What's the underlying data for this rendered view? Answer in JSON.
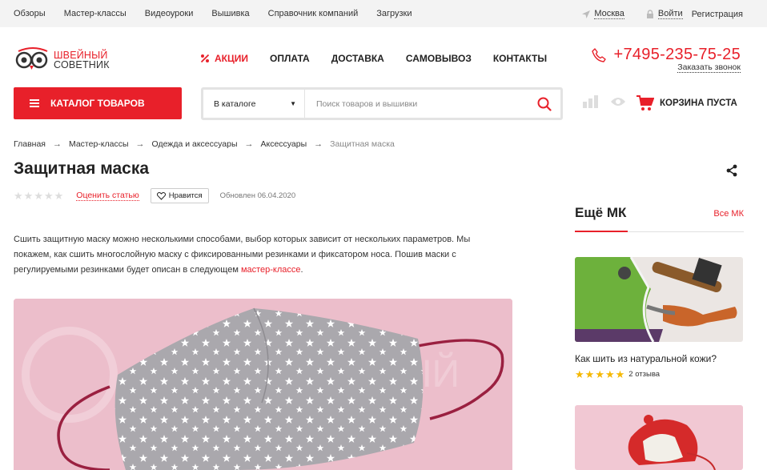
{
  "topbar": {
    "nav": [
      "Обзоры",
      "Мастер-классы",
      "Видеоуроки",
      "Вышивка",
      "Справочник компаний",
      "Загрузки"
    ],
    "city": "Москва",
    "login": "Войти",
    "register": "Регистрация"
  },
  "header": {
    "logo_line1": "ШВЕЙНЫЙ",
    "logo_line2": "СОВЕТНИК",
    "nav": [
      "АКЦИИ",
      "ОПЛАТА",
      "ДОСТАВКА",
      "САМОВЫВОЗ",
      "КОНТАКТЫ"
    ],
    "phone": "+7495-235-75-25",
    "callback": "Заказать звонок"
  },
  "catalog_button": "КАТАЛОГ ТОВАРОВ",
  "search": {
    "scope": "В каталоге",
    "placeholder": "Поиск товаров и вышивки"
  },
  "cart_label": "КОРЗИНА ПУСТА",
  "breadcrumb": [
    "Главная",
    "Мастер-классы",
    "Одежда и аксессуары",
    "Аксессуары",
    "Защитная маска"
  ],
  "article": {
    "title": "Защитная маска",
    "rating_stars": 0,
    "rate_link": "Оценить статью",
    "like_label": "Нравится",
    "updated": "Обновлен 06.04.2020",
    "intro_text": "Сшить защитную маску можно несколькими способами, выбор которых зависит от нескольких параметров. Мы покажем, как сшить многослойную маску с фиксированными резинками и фиксатором носа. Пошив маски с регулируемыми резинками будет описан в следующем ",
    "intro_link": "мастер-классе",
    "intro_end": "."
  },
  "sidebar": {
    "heading": "Ещё МК",
    "all_link": "Все МК",
    "cards": [
      {
        "title": "Как шить из натуральной кожи?",
        "stars": 5,
        "reviews": "2 отзыва"
      }
    ]
  },
  "colors": {
    "accent": "#e8202a",
    "star": "#f5b800"
  }
}
